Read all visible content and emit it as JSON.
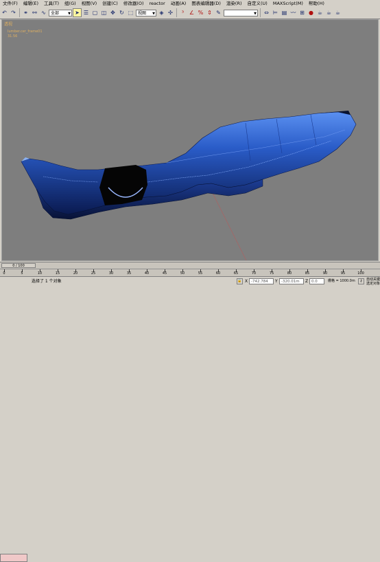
{
  "menubar": {
    "items": [
      "文件(F)",
      "编辑(E)",
      "工具(T)",
      "组(G)",
      "视图(V)",
      "创建(C)",
      "修改器(O)",
      "reactor",
      "动画(A)",
      "图表编辑器(D)",
      "渲染(R)",
      "自定义(U)",
      "MAXScript(M)",
      "帮助(H)"
    ]
  },
  "toolbar": {
    "selection_filter": "全部",
    "ref_coord": "视图"
  },
  "viewport": {
    "label": "透视",
    "object_info_line1": "Iumber.cer_frame01",
    "object_info_line2": "31.56"
  },
  "trackbar": {
    "frame_counter": "0 / 100"
  },
  "timeline": {
    "ticks": [
      "0",
      "5",
      "10",
      "15",
      "20",
      "25",
      "30",
      "35",
      "40",
      "45",
      "50",
      "55",
      "60",
      "65",
      "70",
      "75",
      "80",
      "85",
      "90",
      "95",
      "100"
    ]
  },
  "statusbar": {
    "selection_text": "选择了 1 个对象",
    "x_value": "-742.784",
    "y_value": "-320.01m",
    "z_value": "0.0",
    "auto_key_label": "自动关键点",
    "grid_text": "栅格 = 1000.0m",
    "selected_label": "选定对象"
  },
  "colors": {
    "ui_gray": "#d4d0c8",
    "viewport_bg": "#7e7e7e",
    "model_blue": "#2a5cc8",
    "axis_red": "#d04040"
  }
}
